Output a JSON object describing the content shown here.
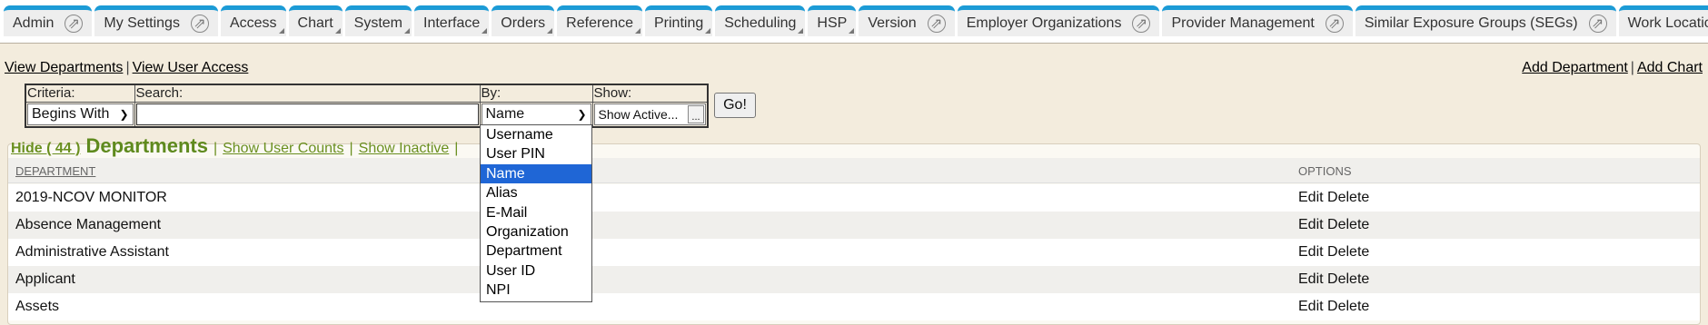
{
  "nav": {
    "tabs": [
      {
        "label": "Admin",
        "ext": true
      },
      {
        "label": "My Settings",
        "ext": true
      },
      {
        "label": "Access",
        "corner": true
      },
      {
        "label": "Chart",
        "corner": true
      },
      {
        "label": "System",
        "corner": true
      },
      {
        "label": "Interface",
        "corner": true
      },
      {
        "label": "Orders",
        "corner": true
      },
      {
        "label": "Reference",
        "corner": true
      },
      {
        "label": "Printing",
        "corner": true
      },
      {
        "label": "Scheduling",
        "corner": true
      },
      {
        "label": "HSP",
        "corner": true
      },
      {
        "label": "Version",
        "ext": true
      },
      {
        "label": "Employer Organizations",
        "ext": true
      },
      {
        "label": "Provider Management",
        "ext": true
      },
      {
        "label": "Similar Exposure Groups (SEGs)",
        "ext": true
      },
      {
        "label": "Work Locations",
        "ext": true
      }
    ]
  },
  "links": {
    "view_departments": "View Departments",
    "view_user_access": "View User Access",
    "add_department": "Add Department",
    "add_chart": "Add Chart",
    "separator": "|"
  },
  "criteria": {
    "criteria_label": "Criteria:",
    "search_label": "Search:",
    "by_label": "By:",
    "show_label": "Show:",
    "criteria_value": "Begins With",
    "search_value": "",
    "by_value": "Name",
    "show_value": "Show Active...",
    "show_button": "...",
    "go_button": "Go!"
  },
  "by_options": [
    "Username",
    "User PIN",
    "Name",
    "Alias",
    "E-Mail",
    "Organization",
    "Department",
    "User ID",
    "NPI"
  ],
  "by_selected_index": 2,
  "panel": {
    "hide_label": "Hide ( 44 )",
    "title": "Departments",
    "show_user_counts": "Show User Counts",
    "show_inactive": "Show Inactive",
    "separator": "|"
  },
  "table": {
    "col_department": "DEPARTMENT",
    "col_options": "OPTIONS",
    "edit_label": "Edit",
    "delete_label": "Delete",
    "rows": [
      "2019-NCOV MONITOR",
      "Absence Management",
      "Administrative Assistant",
      "Applicant",
      "Assets"
    ]
  },
  "colors": {
    "tab_accent": "#1c9bd6",
    "title_green": "#5f8a1e",
    "selected_option": "#1f66d6"
  }
}
